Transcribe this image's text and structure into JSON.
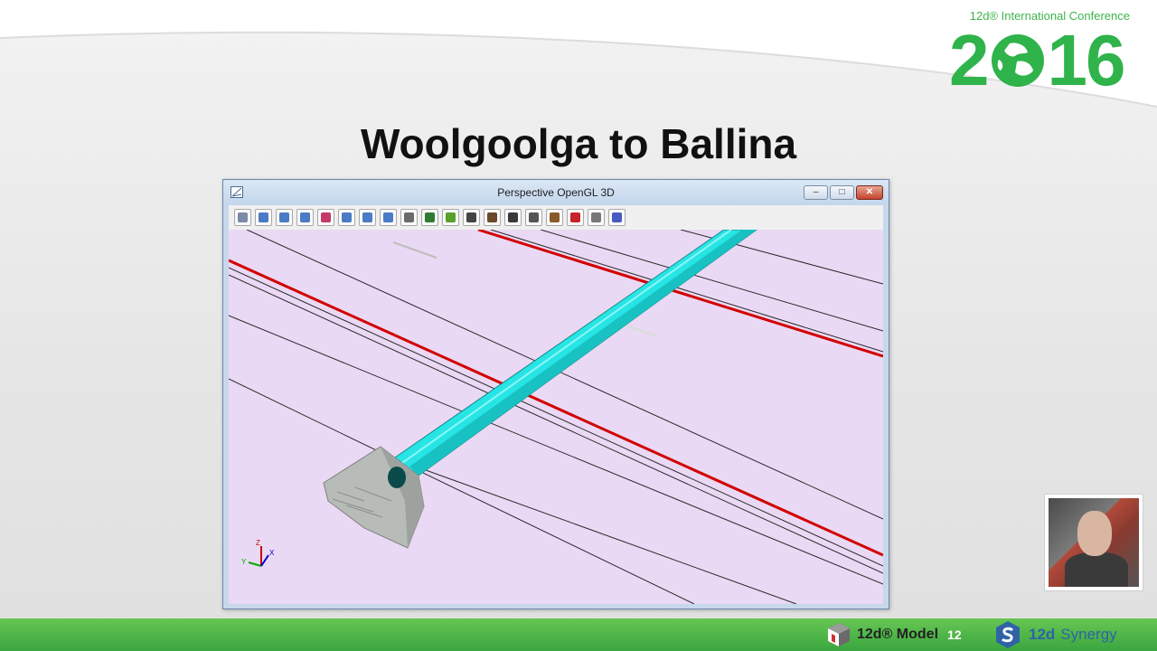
{
  "conference": {
    "subtitle": "12d® International Conference",
    "year_left": "2",
    "year_right": "16"
  },
  "slide": {
    "title": "Woolgoolga to Ballina"
  },
  "window": {
    "title": "Perspective OpenGL 3D",
    "min_label": "–",
    "max_label": "□",
    "close_label": "✕"
  },
  "toolbar": {
    "icons": [
      "redraw-icon",
      "pan-icon",
      "zoom-out-icon",
      "zoom-in-icon",
      "zoom-to-point-icon",
      "zoom-window-icon",
      "zoom-extent-icon",
      "zoom-icon",
      "tilt-icon",
      "eye-icon",
      "fly-icon",
      "camera-icon",
      "lighting-icon",
      "walk-icon",
      "steering-wheel-icon",
      "drape-icon",
      "print-icon",
      "copy-icon",
      "settings-icon"
    ]
  },
  "viewport": {
    "background": "#ead9f4",
    "tube_color": "#27e5e5",
    "line_red": "#d20000",
    "line_black": "#222222",
    "axis_labels": {
      "z": "Z",
      "y": "Y",
      "x": "X"
    }
  },
  "footer": {
    "model_label": "12d® Model",
    "model_version": "12",
    "synergy_12d": "12d",
    "synergy_name": "Synergy"
  }
}
